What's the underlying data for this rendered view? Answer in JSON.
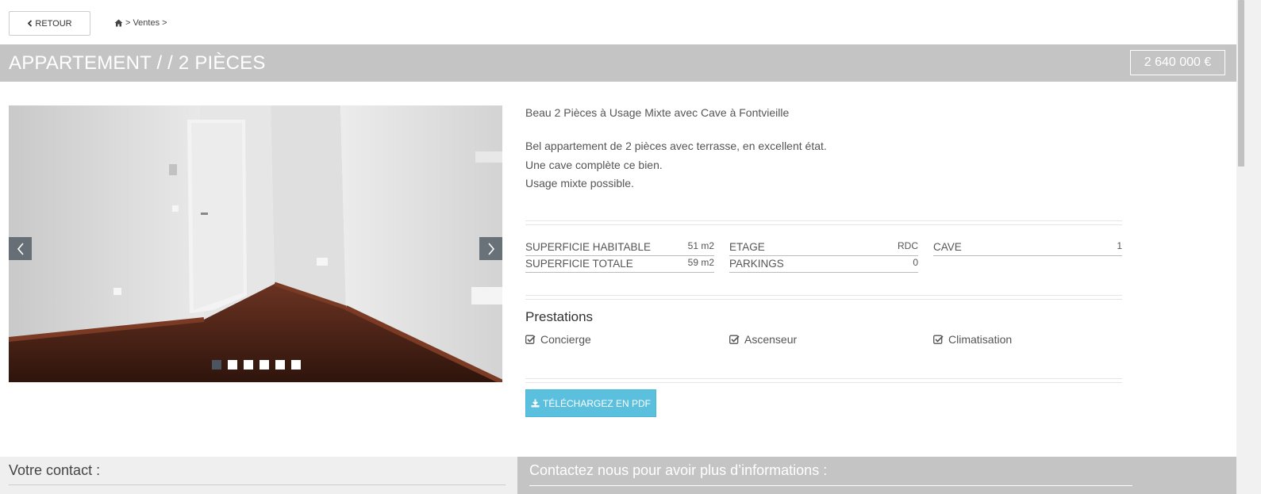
{
  "nav": {
    "back_label": "RETOUR",
    "breadcrumb": {
      "home_icon": "home-icon",
      "sep1": ">",
      "item": "Ventes",
      "sep2": ">"
    }
  },
  "listing": {
    "title": "APPARTEMENT / / 2 PIÈCES",
    "price": "2 640 000 €",
    "short_title": "Beau 2 Pièces à Usage Mixte avec Cave à Fontvieille",
    "description": [
      "Bel appartement de 2 pièces avec terrasse, en excellent état.",
      "Une cave complète ce bien.",
      "Usage mixte possible."
    ],
    "features": [
      {
        "label": "SUPERFICIE HABITABLE",
        "value": "51 m2"
      },
      {
        "label": "SUPERFICIE TOTALE",
        "value": "59 m2"
      },
      {
        "label": "ETAGE",
        "value": "RDC"
      },
      {
        "label": "PARKINGS",
        "value": "0"
      },
      {
        "label": "CAVE",
        "value": "1"
      }
    ],
    "prestations_title": "Prestations",
    "prestations": [
      "Concierge",
      "Ascenseur",
      "Climatisation"
    ],
    "pdf_label": "TÉLÉCHARGEZ EN PDF"
  },
  "carousel": {
    "slide_count": 6,
    "active_index": 0
  },
  "contact": {
    "left_title": "Votre contact :",
    "right_title": "Contactez nous pour avoir plus d’informations :"
  },
  "colors": {
    "title_bar": "#c4c4c4",
    "pdf_button": "#5bc0de",
    "contact_left_bg": "#efefef"
  }
}
